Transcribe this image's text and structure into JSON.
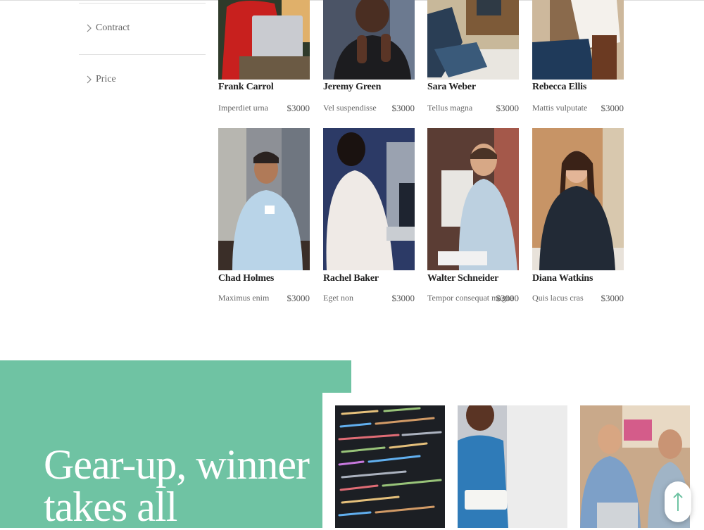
{
  "filters": [
    {
      "label": "Contract"
    },
    {
      "label": "Price"
    }
  ],
  "products": [
    {
      "name": "Frank Carrol",
      "desc": "Imperdiet urna",
      "price": "$3000"
    },
    {
      "name": "Jeremy Green",
      "desc": "Vel suspendisse",
      "price": "$3000"
    },
    {
      "name": "Sara Weber",
      "desc": "Tellus magna",
      "price": "$3000"
    },
    {
      "name": "Rebecca Ellis",
      "desc": "Mattis vulputate",
      "price": "$3000"
    },
    {
      "name": "Chad Holmes",
      "desc": "Maximus enim",
      "price": "$3000"
    },
    {
      "name": "Rachel Baker",
      "desc": "Eget non",
      "price": "$3000"
    },
    {
      "name": "Walter Schneider",
      "desc": "Tempor consequat magna",
      "price": "$3000"
    },
    {
      "name": "Diana Watkins",
      "desc": "Quis lacus cras",
      "price": "$3000"
    }
  ],
  "promo": {
    "title": "Gear-up, winner takes all"
  },
  "colors": {
    "accent": "#6fc3a3",
    "scroll_top_arrow": "#6fc3a3"
  },
  "icons": {
    "filter_chevron": "chevron-right-icon",
    "scroll_top": "arrow-up-icon"
  }
}
